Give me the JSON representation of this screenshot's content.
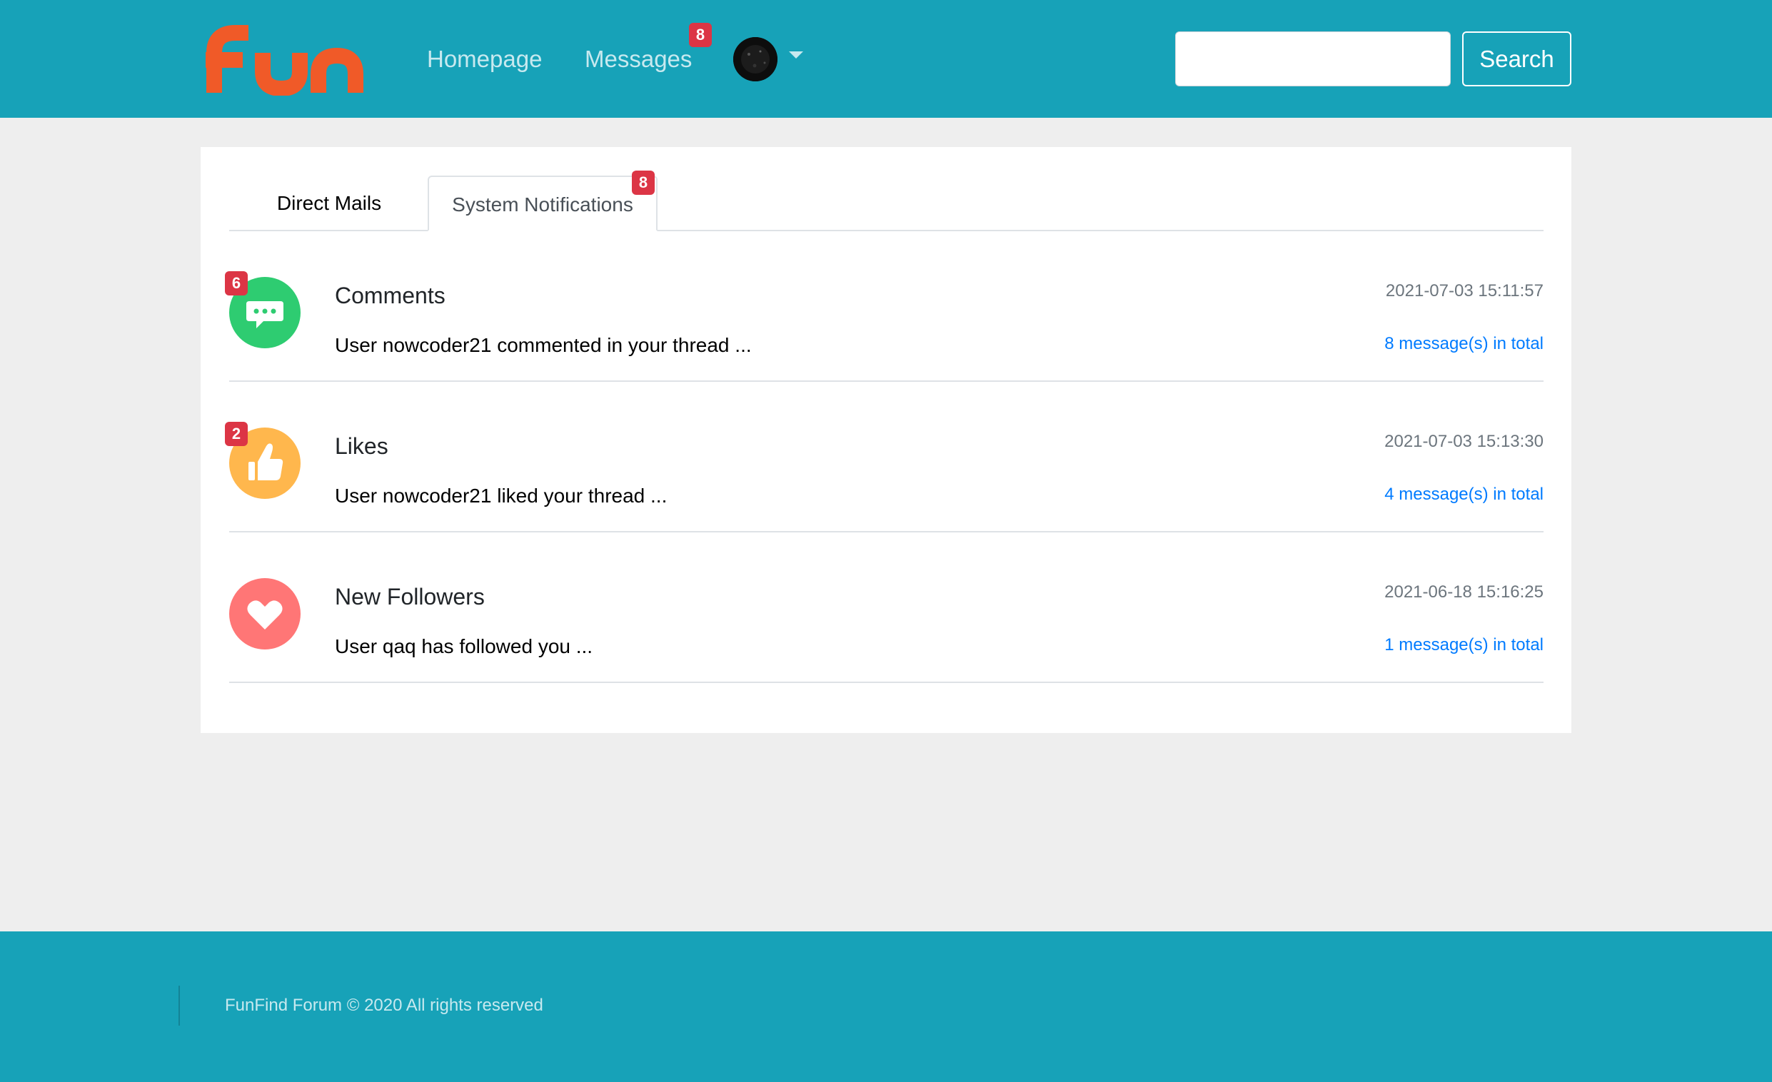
{
  "header": {
    "logo_text": "fun",
    "nav": {
      "home_label": "Homepage",
      "messages_label": "Messages",
      "messages_badge": "8"
    },
    "search": {
      "value": "",
      "button_label": "Search"
    }
  },
  "tabs": {
    "direct_label": "Direct Mails",
    "system_label": "System Notifications",
    "system_badge": "8",
    "active": "System Notifications"
  },
  "notices": [
    {
      "title": "Comments",
      "text": "User nowcoder21 commented in your thread ...",
      "time": "2021-07-03 15:11:57",
      "count": "8 message(s) in total",
      "badge": "6",
      "icon": "comment-icon",
      "color": "#2ecc71"
    },
    {
      "title": "Likes",
      "text": "User nowcoder21 liked your thread ...",
      "time": "2021-07-03 15:13:30",
      "count": "4 message(s) in total",
      "badge": "2",
      "icon": "thumbs-up-icon",
      "color": "#ffb74d"
    },
    {
      "title": "New Followers",
      "text": "User qaq has followed you ...",
      "time": "2021-06-18 15:16:25",
      "count": "1 message(s) in total",
      "badge": "",
      "icon": "heart-icon",
      "color": "#ff7676"
    }
  ],
  "footer": {
    "copyright": "FunFind Forum © 2020 All rights reserved"
  },
  "colors": {
    "brand": "#17a2b8",
    "logo": "#f05a28",
    "badge": "#dc3545",
    "link": "#007bff"
  }
}
